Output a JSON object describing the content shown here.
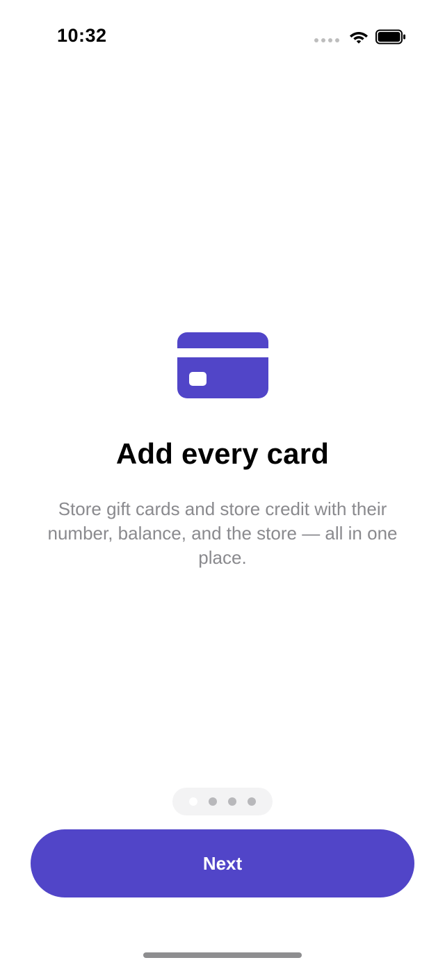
{
  "status_bar": {
    "time": "10:32"
  },
  "onboarding": {
    "title": "Add every card",
    "description": "Store gift cards and store credit with their number, balance, and the store — all in one place.",
    "page_count": 4,
    "current_page": 1
  },
  "actions": {
    "next_label": "Next"
  },
  "colors": {
    "accent": "#5145c8",
    "description_text": "#8a8a8e"
  },
  "icons": {
    "hero": "credit-card-icon",
    "wifi": "wifi-icon",
    "battery": "battery-icon",
    "signal": "signal-dots-icon"
  }
}
